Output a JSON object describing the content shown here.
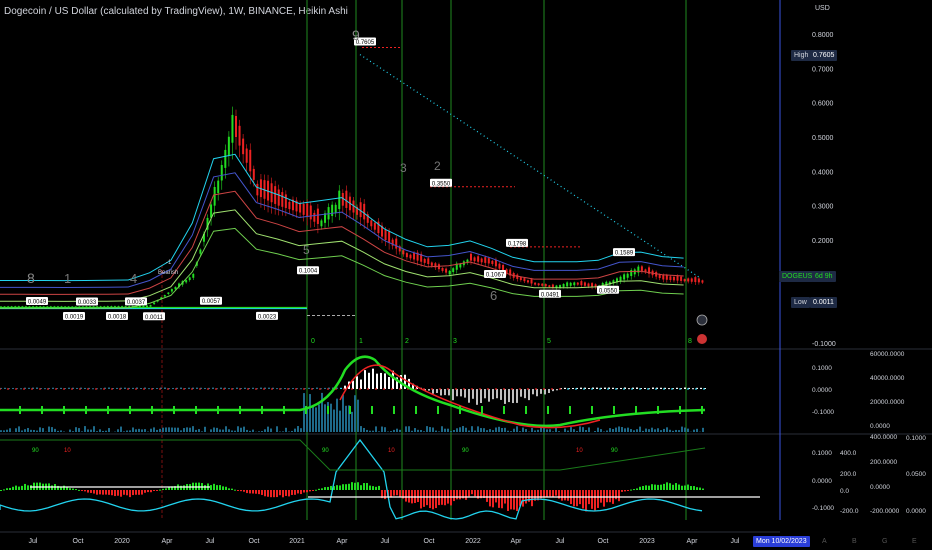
{
  "title": "Dogecoin / US Dollar (calculated by TradingView), 1W, BINANCE, Heikin Ashi",
  "currency_label": "USD",
  "colors": {
    "background": "#000000",
    "bull": "#22dd22",
    "bear": "#ee2222",
    "cyan": "#22d3ee",
    "grid_green": "#1f8a1f",
    "grid_red": "#7a1010",
    "today_line": "#3a55e0",
    "axis_text": "#d1d4dc"
  },
  "scale_tags": {
    "high_label": "High",
    "high_value": "0.7605",
    "symbol_label": "DOGEUSD",
    "symbol_countdown": "6d 9h",
    "low_label": "Low",
    "low_value": "0.0011"
  },
  "time_tag": "Mon 10/02/2023",
  "chart_data": [
    {
      "type": "candlestick",
      "pane": "price",
      "ylim": [
        -0.1,
        0.8
      ],
      "y_ticks": [
        "0.8000",
        "0.7000",
        "0.6000",
        "0.5000",
        "0.4000",
        "0.3000",
        "0.2000",
        "0.1000",
        "-0.1000"
      ],
      "x_ticks": [
        "Jul",
        "Oct",
        "2020",
        "Apr",
        "Jul",
        "Oct",
        "2021",
        "Apr",
        "Jul",
        "Oct",
        "2022",
        "Apr",
        "Jul",
        "Oct",
        "2023",
        "Apr",
        "Jul"
      ],
      "ohlc_path": [
        [
          0.002,
          0.003
        ],
        [
          0.0025,
          0.0025
        ],
        [
          0.0023,
          0.0023
        ],
        [
          0.002,
          0.002
        ],
        [
          0.0025,
          0.0025
        ],
        [
          0.003,
          0.003
        ],
        [
          0.003,
          0.005
        ],
        [
          0.006,
          0.05
        ],
        [
          0.05,
          0.09
        ],
        [
          0.09,
          0.3
        ],
        [
          0.3,
          0.52
        ],
        [
          0.5,
          0.35
        ],
        [
          0.33,
          0.3
        ],
        [
          0.3,
          0.28
        ],
        [
          0.28,
          0.24
        ],
        [
          0.24,
          0.3
        ],
        [
          0.3,
          0.26
        ],
        [
          0.26,
          0.2
        ],
        [
          0.2,
          0.15
        ],
        [
          0.15,
          0.13
        ],
        [
          0.13,
          0.1
        ],
        [
          0.1,
          0.14
        ],
        [
          0.14,
          0.13
        ],
        [
          0.13,
          0.09
        ],
        [
          0.09,
          0.07
        ],
        [
          0.07,
          0.06
        ],
        [
          0.06,
          0.07
        ],
        [
          0.07,
          0.06
        ],
        [
          0.06,
          0.08
        ],
        [
          0.08,
          0.11
        ],
        [
          0.11,
          0.085
        ],
        [
          0.085,
          0.08
        ],
        [
          0.08,
          0.075
        ]
      ],
      "price_labels": [
        "0.7605",
        "0.3550",
        "0.1798",
        "0.1589",
        "0.1004",
        "0.1067",
        "0.0491",
        "0.0550",
        "0.0049",
        "0.0033",
        "0.0037",
        "0.0057",
        "0.0019",
        "0.0018",
        "0.0011",
        "0.0023"
      ],
      "annotations": [
        "Bearish",
        "-1",
        "8",
        "9",
        "5",
        "3",
        "2",
        "1",
        "4",
        "6"
      ],
      "cycle_marks": [
        "0",
        "1",
        "2",
        "3",
        "5",
        "8"
      ]
    },
    {
      "type": "histogram",
      "pane": "oscillator-1",
      "left_ticks": [
        "0.1000",
        "0.0000",
        "-0.1000"
      ],
      "right_ticks": [
        "0.1000",
        "0.0000",
        "-0.1000"
      ],
      "volume_ticks": [
        "60000.0000",
        "40000.0000",
        "20000.0000",
        "0.0000"
      ]
    },
    {
      "type": "histogram",
      "pane": "oscillator-2",
      "left_ticks": [
        "0.1000",
        "0.0000",
        "-0.1000"
      ],
      "mid_ticks": [
        "400.0",
        "200.0",
        "0.0",
        "-200.0"
      ],
      "right_ticks": [
        "400.0000",
        "200.0000",
        "0.0000",
        "-200.0000"
      ],
      "far_right_ticks": [
        "0.1000",
        "0.0500",
        "0.0000"
      ],
      "markers": [
        "90",
        "10"
      ]
    }
  ]
}
